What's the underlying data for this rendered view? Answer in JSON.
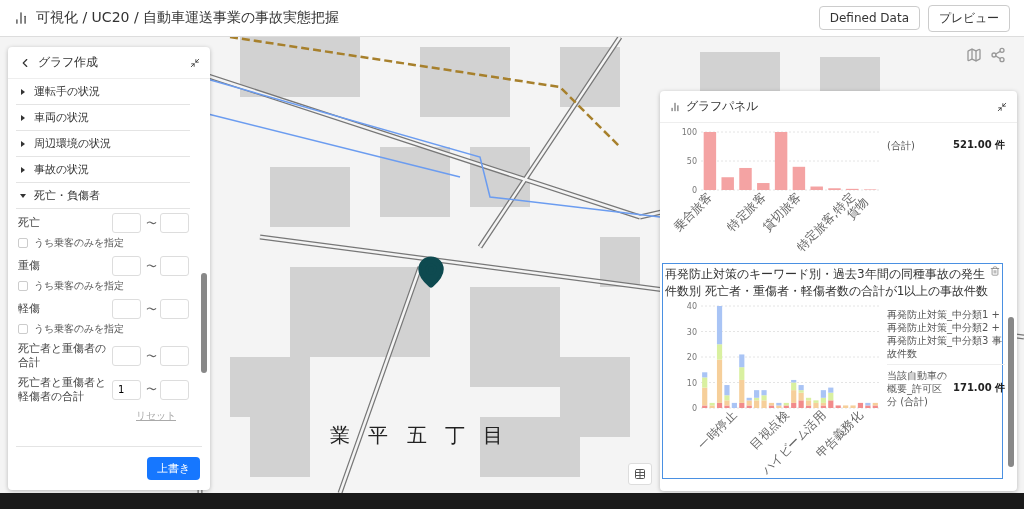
{
  "header": {
    "breadcrumb": "可視化 / UC20 / 自動車運送事業の事故実態把握",
    "buttons": [
      "Defined Data",
      "プレビュー"
    ]
  },
  "map": {
    "place_label": "業 平 五 丁 目"
  },
  "editor": {
    "title": "グラフ作成",
    "sections": [
      {
        "label": "運転手の状況",
        "expanded": false
      },
      {
        "label": "車両の状況",
        "expanded": false
      },
      {
        "label": "周辺環境の状況",
        "expanded": false
      },
      {
        "label": "事故の状況",
        "expanded": false
      },
      {
        "label": "死亡・負傷者",
        "expanded": true
      }
    ],
    "range_separator": "〜",
    "fields": [
      {
        "label": "死亡",
        "option": {
          "label": "うち乗客のみを指定",
          "checked": false
        }
      },
      {
        "label": "重傷",
        "option": {
          "label": "うち乗客のみを指定",
          "checked": false
        }
      },
      {
        "label": "軽傷",
        "option": {
          "label": "うち乗客のみを指定",
          "checked": false
        }
      },
      {
        "label": "死亡者と重傷者の合計"
      },
      {
        "label": "死亡者と重傷者と軽傷者の合計",
        "min": "1"
      }
    ],
    "reset": "リセット",
    "submit": "上書き"
  },
  "graph_panel": {
    "title": "グラフパネル",
    "charts": [
      {
        "selected": false,
        "summary_label": "(合計)",
        "summary_value": "521.00 件",
        "chart_data": {
          "type": "bar",
          "categories": [
            "乗合旅客",
            null,
            null,
            "特定旅客",
            null,
            "貸切旅客",
            null,
            null,
            "特定旅客,特定貨物",
            null
          ],
          "series": [
            {
              "color": "#f4a3a3",
              "values": [
                100,
                22,
                38,
                12,
                100,
                40,
                6,
                3,
                2,
                1
              ]
            }
          ],
          "ylim": [
            0,
            100
          ],
          "yticks": [
            0,
            50,
            100
          ],
          "grid": true
        }
      },
      {
        "selected": true,
        "title": "再発防止対策のキーワード別・過去3年間の同種事故の発生件数別 死亡者・重傷者・軽傷者数の合計が1以上の事故件数",
        "legend": "再発防止対策_中分類1 + 再発防止対策_中分類2 + 再発防止対策_中分類3 事故件数",
        "summary_label": "当該自動車の概要_許可区分 (合計)",
        "summary_value": "171.00 件",
        "chart_data": {
          "type": "bar",
          "stacked": true,
          "categories": [
            null,
            null,
            null,
            null,
            "一時停止",
            null,
            null,
            null,
            null,
            null,
            null,
            "目視点検",
            null,
            null,
            null,
            null,
            "ハイビーム活用",
            null,
            null,
            null,
            null,
            "申告義務化",
            null,
            null
          ],
          "series": [
            {
              "color": "#f28b8b",
              "values": [
                1,
                0,
                2,
                1,
                0,
                2,
                1,
                0,
                0,
                1,
                0,
                1,
                2,
                3,
                1,
                0,
                1,
                3,
                1,
                0,
                0,
                2,
                1,
                1
              ]
            },
            {
              "color": "#f6cf9a",
              "values": [
                7,
                1,
                17,
                2,
                0,
                9,
                2,
                3,
                3,
                1,
                1,
                0,
                5,
                3,
                2,
                2,
                1,
                0,
                0,
                1,
                1,
                0,
                0,
                1
              ]
            },
            {
              "color": "#d9f0a0",
              "values": [
                4,
                1,
                6,
                2,
                0,
                5,
                0,
                1,
                2,
                0,
                0,
                1,
                3,
                1,
                1,
                1,
                2,
                3,
                0,
                0,
                0,
                0,
                0,
                0
              ]
            },
            {
              "color": "#a9c4f5",
              "values": [
                2,
                0,
                15,
                4,
                2,
                5,
                1,
                3,
                2,
                0,
                1,
                0,
                1,
                2,
                0,
                0,
                3,
                2,
                0,
                0,
                0,
                0,
                1,
                0
              ]
            }
          ],
          "ylim": [
            0,
            40
          ],
          "yticks": [
            0,
            10,
            20,
            30,
            40
          ],
          "grid": true
        }
      }
    ]
  }
}
